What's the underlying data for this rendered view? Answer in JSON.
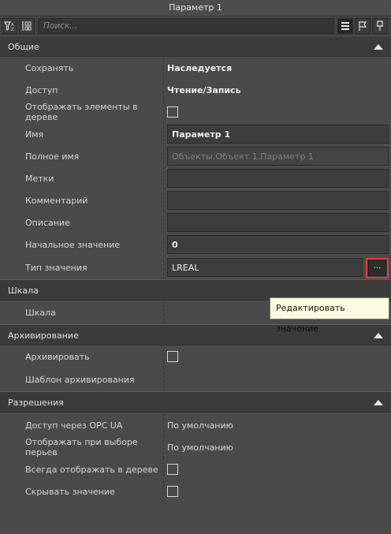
{
  "window": {
    "title": "Параметр 1"
  },
  "toolbar": {
    "search_placeholder": "Поиск..."
  },
  "sections": {
    "general": {
      "title": "Общие",
      "rows": {
        "save": {
          "label": "Сохранять",
          "value": "Наследуется"
        },
        "access": {
          "label": "Доступ",
          "value": "Чтение/Запись"
        },
        "show_in_tree": {
          "label": "Отображать элементы в дереве"
        },
        "name": {
          "label": "Имя",
          "value": "Параметр 1"
        },
        "full_name": {
          "label": "Полное имя",
          "value": "Объекты.Объект 1.Параметр 1"
        },
        "tags": {
          "label": "Метки",
          "value": ""
        },
        "comment": {
          "label": "Комментарий",
          "value": ""
        },
        "description": {
          "label": "Описание",
          "value": ""
        },
        "initial_value": {
          "label": "Начальное значение",
          "value": "0"
        },
        "value_type": {
          "label": "Тип значения",
          "value": "LREAL",
          "button": "..."
        }
      }
    },
    "scale": {
      "title": "Шкала",
      "rows": {
        "scale": {
          "label": "Шкала"
        }
      }
    },
    "archive": {
      "title": "Архивирование",
      "rows": {
        "archive": {
          "label": "Архивировать"
        },
        "template": {
          "label": "Шаблон архивирования"
        }
      }
    },
    "permissions": {
      "title": "Разрешения",
      "rows": {
        "opc": {
          "label": "Доступ через OPC UA",
          "value": "По умолчанию"
        },
        "pens": {
          "label": "Отображать при выборе перьев",
          "value": "По умолчанию"
        },
        "always_tree": {
          "label": "Всегда отображать в дереве"
        },
        "hide_value": {
          "label": "Скрывать значение"
        }
      }
    }
  },
  "tooltip": {
    "text": "Редактировать значение"
  }
}
